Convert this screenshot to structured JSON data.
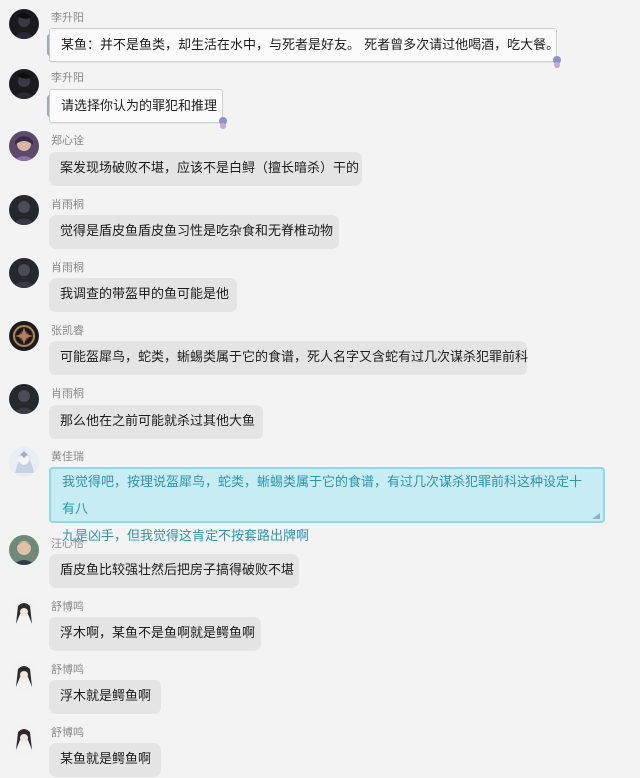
{
  "messages": [
    {
      "name": "李升阳",
      "text": "某鱼：并不是鱼类，却生活在水中，与死者是好友。 死者曾多次请过他喝酒，吃大餐。",
      "avatar": "dark-anime-avatar",
      "bubble_style": "decorated"
    },
    {
      "name": "李升阳",
      "text": "请选择你认为的罪犯和推理",
      "avatar": "dark-anime-avatar",
      "bubble_style": "decorated"
    },
    {
      "name": "郑心诠",
      "text": "案发现场破败不堪，应该不是白鲟（擅长暗杀）干的",
      "avatar": "purple-portrait-avatar",
      "bubble_style": "plain"
    },
    {
      "name": "肖雨桐",
      "text": "觉得是盾皮鱼盾皮鱼习性是吃杂食和无脊椎动物",
      "avatar": "dark-avatar",
      "bubble_style": "plain"
    },
    {
      "name": "肖雨桐",
      "text": "我调查的带盔甲的鱼可能是他",
      "avatar": "dark-avatar",
      "bubble_style": "plain"
    },
    {
      "name": "张凯睿",
      "text": "可能盔犀鸟，蛇类，蜥蜴类属于它的食谱，死人名字又含蛇有过几次谋杀犯罪前科",
      "avatar": "emblem-avatar",
      "bubble_style": "plain"
    },
    {
      "name": "肖雨桐",
      "text": "那么他在之前可能就杀过其他大鱼",
      "avatar": "dark-avatar",
      "bubble_style": "plain"
    },
    {
      "name": "黄佳瑞",
      "text_lines": [
        "我觉得吧，按理说盔犀鸟，蛇类，蜥蜴类属于它的食谱，有过几次谋杀犯罪前科这种设定十有八",
        "九是凶手，但我觉得这肯定不按套路出牌啊"
      ],
      "avatar": "white-character-avatar",
      "bubble_style": "highlight-blue"
    },
    {
      "name": "汪心怡",
      "text": "盾皮鱼比较强壮然后把房子搞得破败不堪",
      "avatar": "photo-avatar",
      "bubble_style": "plain"
    },
    {
      "name": "舒博鸣",
      "text": "浮木啊，某鱼不是鱼啊就是鳄鱼啊",
      "avatar": "anime-sketch-avatar",
      "bubble_style": "plain"
    },
    {
      "name": "舒博鸣",
      "text": "浮木就是鳄鱼啊",
      "avatar": "anime-sketch-avatar",
      "bubble_style": "plain"
    },
    {
      "name": "舒博鸣",
      "text": "某鱼就是鳄鱼啊",
      "avatar": "anime-sketch-avatar",
      "bubble_style": "plain"
    }
  ]
}
